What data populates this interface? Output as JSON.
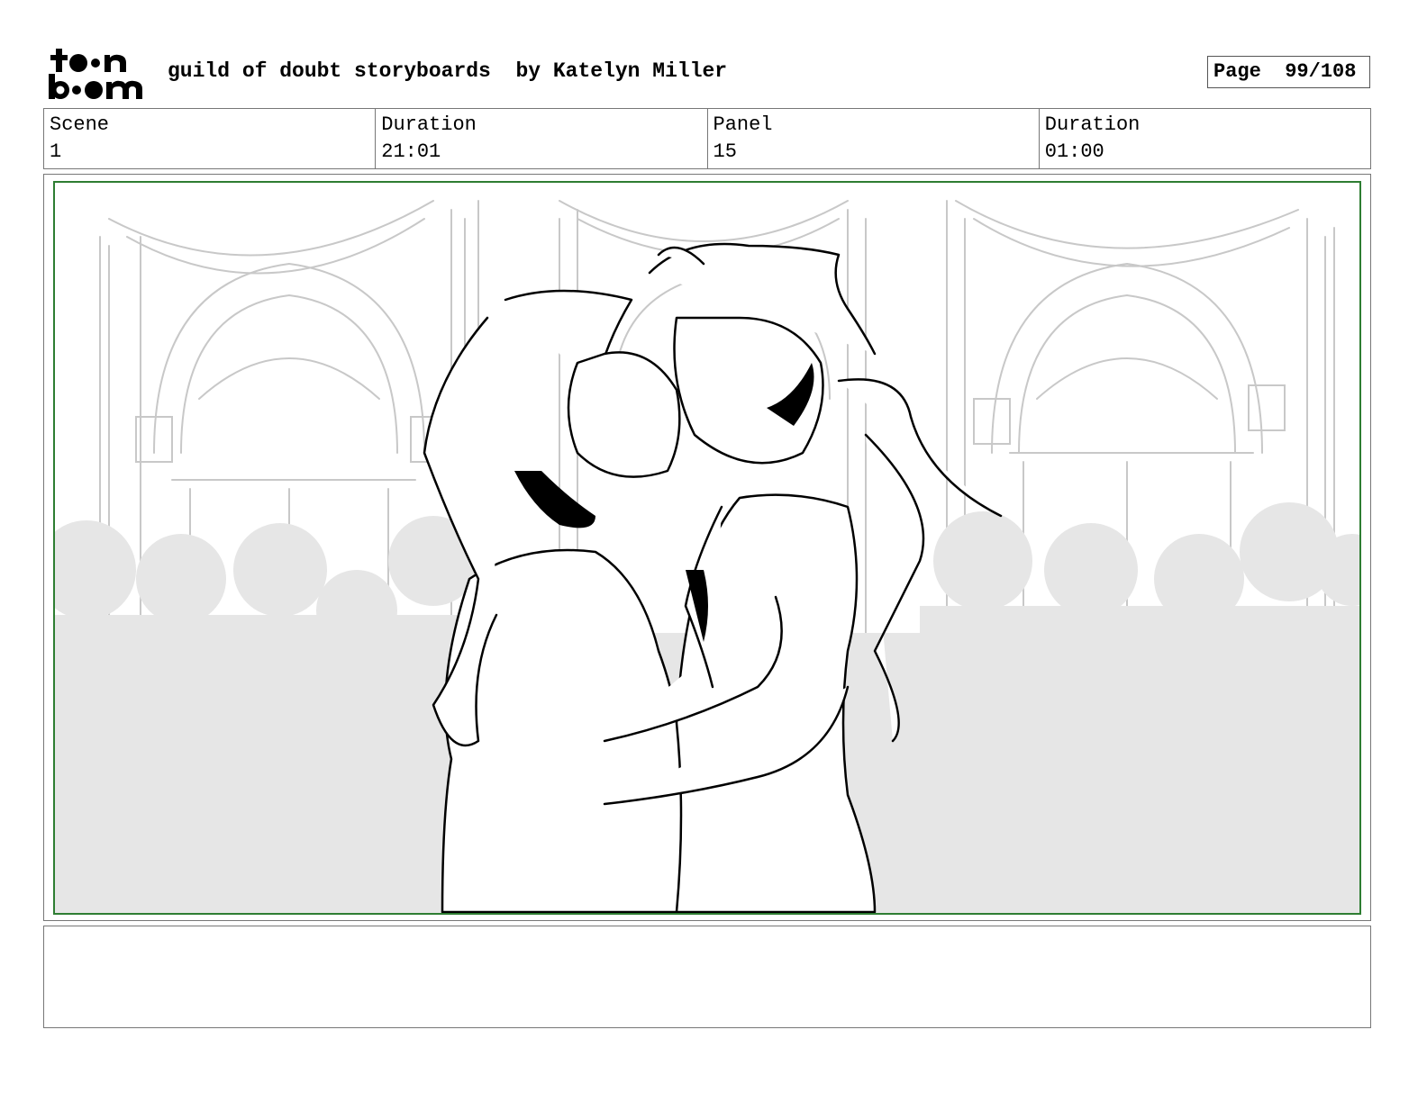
{
  "header": {
    "logo_icon": "toon-boom-logo-icon",
    "title": "guild of doubt storyboards  by Katelyn Miller",
    "page_label": "Page",
    "page_value": "99/108"
  },
  "info": {
    "scene_label": "Scene",
    "scene_value": "1",
    "scene_duration_label": "Duration",
    "scene_duration_value": "21:01",
    "panel_label": "Panel",
    "panel_value": "15",
    "panel_duration_label": "Duration",
    "panel_duration_value": "01:00"
  },
  "panel": {
    "frame_color": "#2e7d32",
    "description": ""
  },
  "notes": {
    "text": ""
  }
}
